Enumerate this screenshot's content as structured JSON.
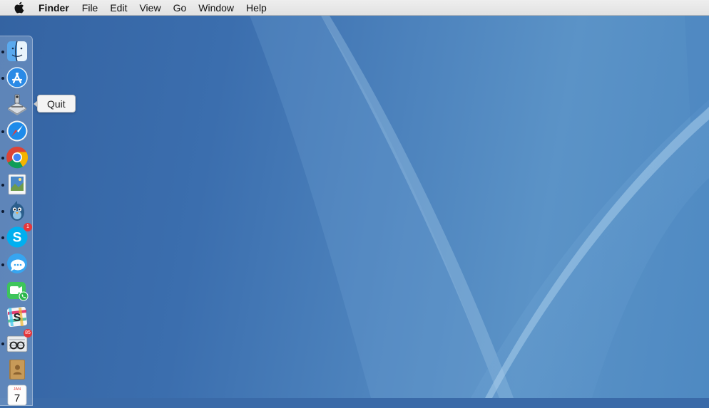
{
  "menubar": {
    "apple_icon": "apple-logo-icon",
    "items": [
      "Finder",
      "File",
      "Edit",
      "View",
      "Go",
      "Window",
      "Help"
    ]
  },
  "dock": {
    "items": [
      {
        "name": "finder",
        "icon": "finder-icon",
        "running": true
      },
      {
        "name": "app-store",
        "icon": "app-store-icon",
        "running": true
      },
      {
        "name": "preview-scanner",
        "icon": "scanner-icon",
        "running": false
      },
      {
        "name": "safari",
        "icon": "safari-icon",
        "running": true
      },
      {
        "name": "chrome",
        "icon": "chrome-icon",
        "running": true
      },
      {
        "name": "preview",
        "icon": "preview-icon",
        "running": true
      },
      {
        "name": "bird-app",
        "icon": "bird-icon",
        "running": true
      },
      {
        "name": "skype",
        "icon": "skype-icon",
        "running": true,
        "badge": "1"
      },
      {
        "name": "messages",
        "icon": "messages-icon",
        "running": true
      },
      {
        "name": "facetime",
        "icon": "facetime-icon",
        "running": false
      },
      {
        "name": "slack",
        "icon": "slack-icon",
        "running": false
      },
      {
        "name": "newsreader",
        "icon": "newsreader-icon",
        "running": true,
        "badge": "85"
      },
      {
        "name": "contacts",
        "icon": "contacts-icon",
        "running": false
      },
      {
        "name": "calendar",
        "icon": "calendar-icon",
        "running": false,
        "label_month": "JAN",
        "label_day": "7"
      }
    ]
  },
  "tooltip": {
    "text": "Quit"
  }
}
